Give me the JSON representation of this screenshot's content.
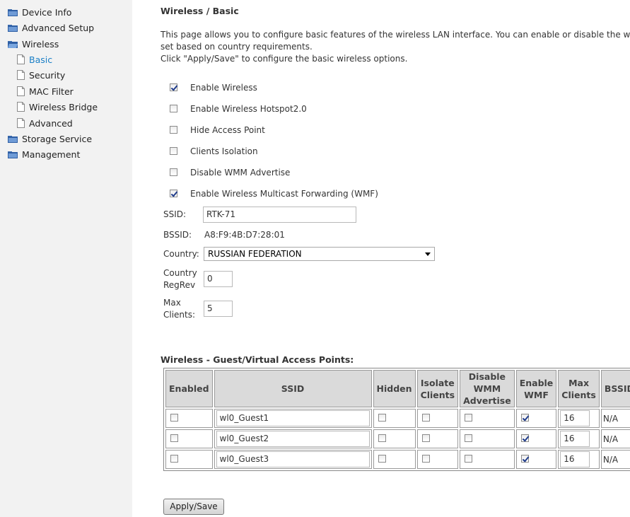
{
  "sidebar": {
    "items": [
      {
        "label": "Device Info",
        "icon": "folder-icon"
      },
      {
        "label": "Advanced Setup",
        "icon": "folder-icon"
      },
      {
        "label": "Wireless",
        "icon": "folder-open-icon"
      },
      {
        "label": "Basic",
        "icon": "page-icon",
        "active": true
      },
      {
        "label": "Security",
        "icon": "page-icon"
      },
      {
        "label": "MAC Filter",
        "icon": "page-icon"
      },
      {
        "label": "Wireless Bridge",
        "icon": "page-icon"
      },
      {
        "label": "Advanced",
        "icon": "page-icon"
      },
      {
        "label": "Storage Service",
        "icon": "folder-icon"
      },
      {
        "label": "Management",
        "icon": "folder-icon"
      }
    ]
  },
  "page": {
    "title": "Wireless / Basic",
    "desc_line1": "This page allows you to configure basic features of the wireless LAN interface. You can enable or disable the wireless",
    "desc_line2": "set based on country requirements.",
    "desc_line3": "Click \"Apply/Save\" to configure the basic wireless options."
  },
  "options": [
    {
      "label": "Enable Wireless",
      "checked": true
    },
    {
      "label": "Enable Wireless Hotspot2.0",
      "checked": false
    },
    {
      "label": "Hide Access Point",
      "checked": false
    },
    {
      "label": "Clients Isolation",
      "checked": false
    },
    {
      "label": "Disable WMM Advertise",
      "checked": false
    },
    {
      "label": "Enable Wireless Multicast Forwarding (WMF)",
      "checked": true
    }
  ],
  "fields": {
    "ssid_label": "SSID:",
    "ssid_value": "RTK-71",
    "bssid_label": "BSSID:",
    "bssid_value": "A8:F9:4B:D7:28:01",
    "country_label": "Country:",
    "country_value": "RUSSIAN FEDERATION",
    "regrev_label_1": "Country",
    "regrev_label_2": "RegRev",
    "regrev_value": "0",
    "maxclients_label_1": "Max",
    "maxclients_label_2": "Clients:",
    "maxclients_value": "5"
  },
  "guest": {
    "title": "Wireless - Guest/Virtual Access Points:",
    "headers": {
      "enabled": "Enabled",
      "ssid": "SSID",
      "hidden": "Hidden",
      "isolate_1": "Isolate",
      "isolate_2": "Clients",
      "wmm_1": "Disable",
      "wmm_2": "WMM",
      "wmm_3": "Advertise",
      "wmf_1": "Enable",
      "wmf_2": "WMF",
      "max_1": "Max",
      "max_2": "Clients",
      "bssid": "BSSID"
    },
    "rows": [
      {
        "enabled": false,
        "ssid": "wl0_Guest1",
        "hidden": false,
        "isolate": false,
        "wmm": false,
        "wmf": true,
        "max": "16",
        "bssid": "N/A"
      },
      {
        "enabled": false,
        "ssid": "wl0_Guest2",
        "hidden": false,
        "isolate": false,
        "wmm": false,
        "wmf": true,
        "max": "16",
        "bssid": "N/A"
      },
      {
        "enabled": false,
        "ssid": "wl0_Guest3",
        "hidden": false,
        "isolate": false,
        "wmm": false,
        "wmf": true,
        "max": "16",
        "bssid": "N/A"
      }
    ]
  },
  "apply_label": "Apply/Save"
}
